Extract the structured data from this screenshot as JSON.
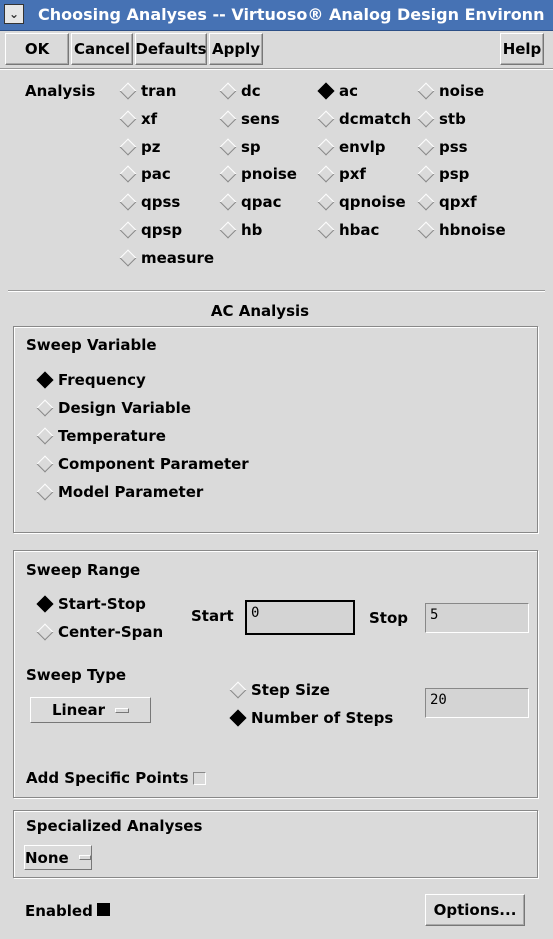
{
  "window": {
    "title": "Choosing Analyses -- Virtuoso® Analog Design Environn",
    "menu_icon": "chevron-down-icon",
    "menu_glyph": "⌄",
    "right_glyph": "⌄"
  },
  "toolbar": {
    "ok": "OK",
    "cancel": "Cancel",
    "defaults": "Defaults",
    "apply": "Apply",
    "help": "Help"
  },
  "analysis": {
    "label": "Analysis",
    "selected": "ac",
    "options": [
      [
        "tran",
        "dc",
        "ac",
        "noise"
      ],
      [
        "xf",
        "sens",
        "dcmatch",
        "stb"
      ],
      [
        "pz",
        "sp",
        "envlp",
        "pss"
      ],
      [
        "pac",
        "pnoise",
        "pxf",
        "psp"
      ],
      [
        "qpss",
        "qpac",
        "qpnoise",
        "qpxf"
      ],
      [
        "qpsp",
        "hb",
        "hbac",
        "hbnoise"
      ],
      [
        "measure"
      ]
    ]
  },
  "ac_section": {
    "heading": "AC Analysis",
    "sweep_variable": {
      "title": "Sweep Variable",
      "selected": "Frequency",
      "options": [
        "Frequency",
        "Design Variable",
        "Temperature",
        "Component Parameter",
        "Model Parameter"
      ]
    },
    "sweep_range": {
      "title": "Sweep Range",
      "modes": [
        "Start-Stop",
        "Center-Span"
      ],
      "selected_mode": "Start-Stop",
      "start_label": "Start",
      "start_value": "0",
      "stop_label": "Stop",
      "stop_value": "5",
      "sweep_type_label": "Sweep Type",
      "sweep_type_value": "Linear",
      "step_options": [
        "Step Size",
        "Number of Steps"
      ],
      "selected_step": "Number of Steps",
      "steps_value": "20",
      "add_points_label": "Add Specific Points",
      "add_points_checked": false
    },
    "specialized": {
      "title": "Specialized Analyses",
      "value": "None"
    }
  },
  "footer": {
    "enabled_label": "Enabled",
    "enabled_checked": true,
    "options_button": "Options..."
  }
}
